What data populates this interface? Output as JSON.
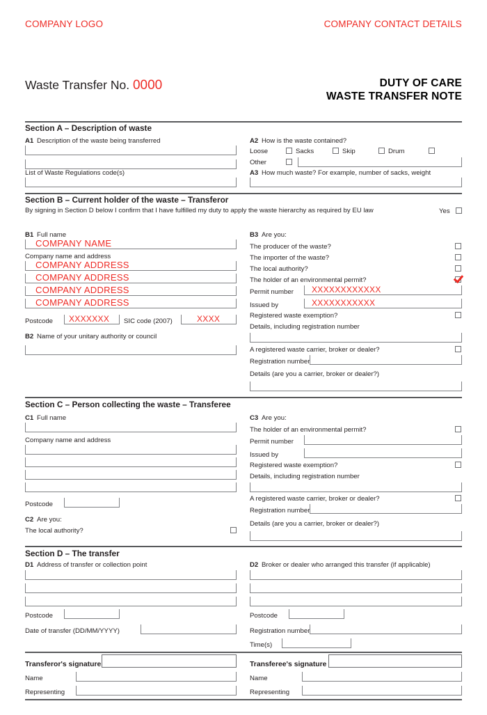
{
  "header": {
    "company_logo": "COMPANY LOGO",
    "company_contact": "COMPANY CONTACT DETAILS",
    "wtn_label": "Waste Transfer No.",
    "wtn_number": "0000",
    "doc_title_line1": "DUTY OF CARE",
    "doc_title_line2": "WASTE TRANSFER NOTE",
    "accent_color": "#ee2a24"
  },
  "section_a": {
    "heading": "Section A – Description of waste",
    "a1_code": "A1",
    "a1_label": "Description of the waste being transferred",
    "a1_line1": "",
    "a1_line2": "",
    "codes_label": "List of  Waste Regulations code(s)",
    "codes_value": "",
    "a2_code": "A2",
    "a2_label": "How is the waste contained?",
    "a2_options": [
      "Loose",
      "Sacks",
      "Skip",
      "Drum"
    ],
    "a2_other_label": "Other",
    "a2_other_value": "",
    "a3_code": "A3",
    "a3_label": "How much waste? For example, number of sacks, weight",
    "a3_value": ""
  },
  "section_b": {
    "heading": "Section B – Current holder of the waste – Transferor",
    "declaration": "By signing in Section D below I confirm that I have fulfilled my duty to apply the waste hierarchy as required by EU law",
    "yes_label": "Yes",
    "b1_code": "B1",
    "b1_label": "Full name",
    "b1_value": "COMPANY NAME",
    "address_label": "Company name and address",
    "address_lines": [
      "COMPANY ADDRESS",
      "COMPANY ADDRESS",
      "COMPANY ADDRESS",
      "COMPANY ADDRESS"
    ],
    "postcode_label": "Postcode",
    "postcode_value": "XXXXXXX",
    "sic_label": "SIC code (2007)",
    "sic_value": "XXXX",
    "b2_code": "B2",
    "b2_label": "Name of your unitary authority or council",
    "b2_value": "",
    "b3_code": "B3",
    "b3_label": "Are you:",
    "q_producer": "The producer of the waste?",
    "q_importer": "The importer of the waste?",
    "q_local_authority": "The local authority?",
    "q_permit_holder": "The holder of an environmental permit?",
    "permit_number_label": "Permit number",
    "permit_number_value": "XXXXXXXXXXXX",
    "issued_by_label": "Issued by",
    "issued_by_value": "XXXXXXXXXXX",
    "q_waste_exemption": "Registered waste exemption?",
    "exemption_details_label": "Details, including registration number",
    "exemption_details_value": "",
    "q_carrier": "A registered waste carrier, broker or dealer?",
    "registration_number_label": "Registration number",
    "registration_number_value": "",
    "carrier_details_label": "Details (are you a carrier, broker or dealer?)",
    "carrier_details_value": ""
  },
  "section_c": {
    "heading": "Section C – Person collecting the waste – Transferee",
    "c1_code": "C1",
    "c1_label": "Full name",
    "c1_value": "",
    "address_label": "Company name and address",
    "address_lines": [
      "",
      "",
      "",
      ""
    ],
    "postcode_label": "Postcode",
    "postcode_value": "",
    "c2_code": "C2",
    "c2_label": "Are you:",
    "q_local_authority": "The local authority?",
    "c3_code": "C3",
    "c3_label": "Are you:",
    "q_permit_holder": "The holder of an environmental permit?",
    "permit_number_label": "Permit number",
    "permit_number_value": "",
    "issued_by_label": "Issued by",
    "issued_by_value": "",
    "q_waste_exemption": "Registered waste exemption?",
    "exemption_details_label": "Details, including registration number",
    "exemption_details_value": "",
    "q_carrier": "A registered waste carrier, broker or dealer?",
    "registration_number_label": "Registration number",
    "registration_number_value": "",
    "carrier_details_label": "Details (are you a carrier, broker or dealer?)",
    "carrier_details_value": ""
  },
  "section_d": {
    "heading": "Section D – The transfer",
    "d1_code": "D1",
    "d1_label": "Address of transfer or collection point",
    "d1_lines": [
      "",
      "",
      ""
    ],
    "d1_postcode_label": "Postcode",
    "d1_postcode_value": "",
    "date_label": "Date of transfer (DD/MM/YYYY)",
    "date_value": "",
    "d2_code": "D2",
    "d2_label": "Broker or dealer who arranged this transfer (if applicable)",
    "d2_lines": [
      "",
      "",
      ""
    ],
    "d2_postcode_label": "Postcode",
    "d2_postcode_value": "",
    "d2_registration_label": "Registration number",
    "d2_registration_value": "",
    "times_label": "Time(s)",
    "times_value": ""
  },
  "signatures": {
    "transferor_signature_label": "Transferor's signature",
    "transferor_signature_value": "",
    "transferor_name_label": "Name",
    "transferor_name_value": "",
    "transferor_representing_label": "Representing",
    "transferor_representing_value": "",
    "transferee_signature_label": "Transferee's signature",
    "transferee_signature_value": "",
    "transferee_name_label": "Name",
    "transferee_name_value": "",
    "transferee_representing_label": "Representing",
    "transferee_representing_value": ""
  }
}
